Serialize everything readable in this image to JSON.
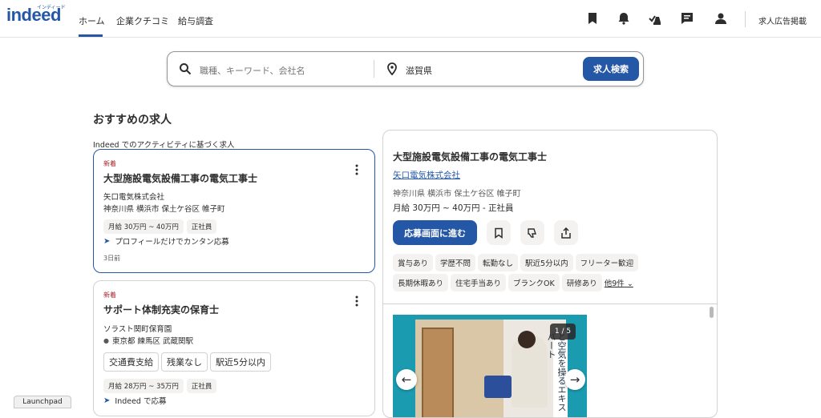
{
  "brand": {
    "logo_text": "indeed",
    "logo_ruby": "インディード",
    "color": "#2557a7"
  },
  "nav": {
    "items": [
      "ホーム",
      "企業クチコミ",
      "給与調査"
    ],
    "active": "ホーム"
  },
  "header_icons": [
    "bookmark-icon",
    "bell-icon",
    "applications-icon",
    "message-icon",
    "account-icon"
  ],
  "header": {
    "employer_link": "求人広告掲載"
  },
  "search": {
    "keyword_placeholder": "職種、キーワード、会社名",
    "location_value": "滋賀県",
    "button_label": "求人検索"
  },
  "section": {
    "title": "おすすめの求人",
    "subtitle": "Indeed でのアクティビティに基づく求人"
  },
  "cards": [
    {
      "badge": "新着",
      "title": "大型施設電気設備工事の電気工事士",
      "company": "矢口電気株式会社",
      "location": "神奈川県 横浜市 保土ケ谷区 帷子町",
      "pills": [
        "月給 30万円 ~ 40万円",
        "正社員"
      ],
      "apply_text": "プロフィールだけでカンタン応募",
      "date": "3日前"
    },
    {
      "badge": "新着",
      "title": "サポート体制充実の保育士",
      "company": "ソラスト関町保育園",
      "location": "東京都 練馬区 武蔵関駅",
      "benefits": [
        "交通費支給",
        "残業なし",
        "駅近5分以内"
      ],
      "pills": [
        "月給 28万円 ~ 35万円",
        "正社員"
      ],
      "apply_text": "Indeed で応募"
    }
  ],
  "detail": {
    "title": "大型施設電気設備工事の電気工事士",
    "company": "矢口電気株式会社",
    "location": "神奈川県 横浜市 保土ケ谷区 帷子町",
    "salary": "月給 30万円 ~ 40万円 - 正社員",
    "apply_label": "応募画面に進む",
    "tags_row1": [
      "賞与あり",
      "学歴不問",
      "転勤なし",
      "駅近5分以内",
      "フリーター歓迎"
    ],
    "tags_row2": [
      "長期休暇あり",
      "住宅手当あり",
      "ブランクOK",
      "研修あり"
    ],
    "more_label": "他9件",
    "image": {
      "counter": "1 / 5",
      "caption": "と空気を操るエキスパート"
    }
  },
  "dock": {
    "launchpad": "Launchpad"
  }
}
